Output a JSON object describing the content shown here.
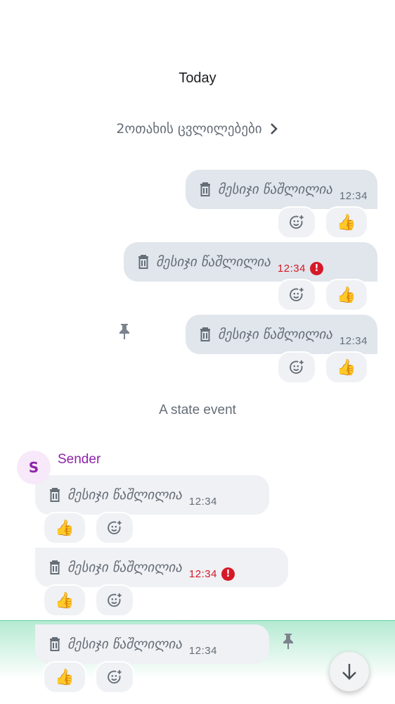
{
  "timeline": {
    "date_separator": "Today",
    "room_changes_summary": "2ოთახის ცვლილებები",
    "state_event": "A state event",
    "sender": {
      "name": "Sender",
      "initial": "S",
      "color": "#8e24aa"
    },
    "outgoing_messages": [
      {
        "text": "მესიჯი წაშლილია",
        "time": "12:34",
        "failed": false,
        "pinned": false,
        "reactions": [
          "👍"
        ]
      },
      {
        "text": "მესიჯი წაშლილია",
        "time": "12:34",
        "failed": true,
        "pinned": false,
        "reactions": [
          "👍"
        ]
      },
      {
        "text": "მესიჯი წაშლილია",
        "time": "12:34",
        "failed": false,
        "pinned": true,
        "reactions": [
          "👍"
        ]
      }
    ],
    "incoming_messages": [
      {
        "text": "მესიჯი წაშლილია",
        "time": "12:34",
        "failed": false,
        "pinned": false,
        "reactions": [
          "👍"
        ]
      },
      {
        "text": "მესიჯი წაშლილია",
        "time": "12:34",
        "failed": true,
        "pinned": false,
        "reactions": [
          "👍"
        ]
      },
      {
        "text": "მესიჯი წაშლილია",
        "time": "12:34",
        "failed": false,
        "pinned": true,
        "highlighted": true,
        "reactions": [
          "👍"
        ]
      }
    ],
    "error_icon": "!",
    "colors": {
      "error": "#d51928",
      "highlight": "#b5ead2",
      "bubble_out": "#e1e6ec",
      "bubble_in": "#eff1f4"
    }
  }
}
